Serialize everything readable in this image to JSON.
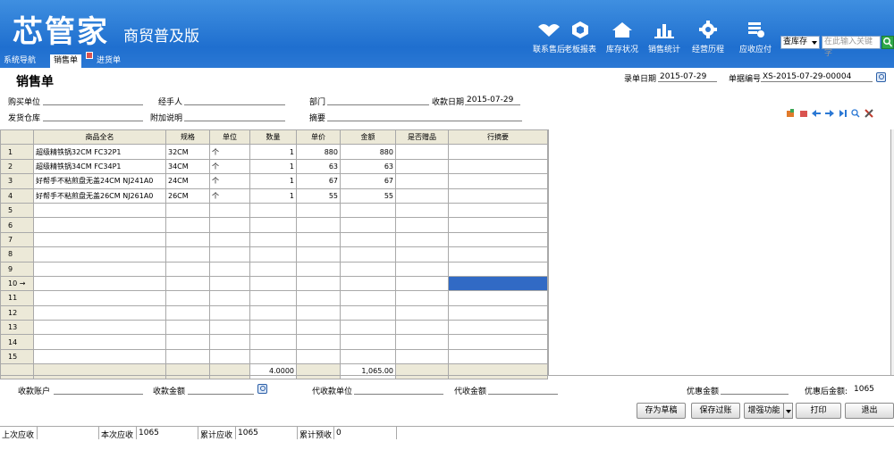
{
  "app": {
    "logo": "芯管家",
    "edition": "商贸普及版"
  },
  "nav": [
    {
      "label": "联系售后",
      "icon": "handshake-icon"
    },
    {
      "label": "老板报表",
      "icon": "report-icon"
    },
    {
      "label": "库存状况",
      "icon": "home-icon"
    },
    {
      "label": "销售统计",
      "icon": "bar-chart-icon"
    },
    {
      "label": "经营历程",
      "icon": "gear-icon"
    },
    {
      "label": "应收应付",
      "icon": "ledger-icon"
    }
  ],
  "search": {
    "scope": "查库存",
    "placeholder": "在此输入关键字"
  },
  "tabs": [
    "系统导航",
    "销售单",
    "进货单"
  ],
  "form": {
    "title": "销售单",
    "entry_date_label": "录单日期",
    "entry_date": "2015-07-29",
    "doc_no_label": "单据编号",
    "doc_no": "XS-2015-07-29-00004",
    "buyer_label": "购买单位",
    "handler_label": "经手人",
    "dept_label": "部门",
    "pay_date_label": "收款日期",
    "pay_date": "2015-07-29",
    "warehouse_label": "发货仓库",
    "note_label": "附加说明",
    "summary_label": "摘要"
  },
  "grid": {
    "headers": [
      "商品全名",
      "规格",
      "单位",
      "数量",
      "单价",
      "金额",
      "是否赠品",
      "行摘要"
    ],
    "rows": [
      {
        "n": "1",
        "name": "超级精铁锅32CM FC32P1",
        "spec": "32CM",
        "unit": "个",
        "qty": "1",
        "price": "880",
        "amount": "880"
      },
      {
        "n": "2",
        "name": "超级精铁锅34CM FC34P1",
        "spec": "34CM",
        "unit": "个",
        "qty": "1",
        "price": "63",
        "amount": "63"
      },
      {
        "n": "3",
        "name": "好帮手不粘煎盘无盖24CM NJ241A0",
        "spec": "24CM",
        "unit": "个",
        "qty": "1",
        "price": "67",
        "amount": "67"
      },
      {
        "n": "4",
        "name": "好帮手不粘煎盘无盖26CM NJ261A0",
        "spec": "26CM",
        "unit": "个",
        "qty": "1",
        "price": "55",
        "amount": "55"
      },
      {
        "n": "5"
      },
      {
        "n": "6"
      },
      {
        "n": "7"
      },
      {
        "n": "8"
      },
      {
        "n": "9"
      },
      {
        "n": "10 →"
      },
      {
        "n": "11"
      },
      {
        "n": "12"
      },
      {
        "n": "13"
      },
      {
        "n": "14"
      },
      {
        "n": "15"
      }
    ],
    "total_qty": "4.0000",
    "total_amount": "1,065.00"
  },
  "footer": {
    "account_label": "收款账户",
    "received_label": "收款金额",
    "agent_unit_label": "代收款单位",
    "agent_amount_label": "代收金额",
    "discount_label": "优惠金额",
    "after_discount_label": "优惠后金额:",
    "after_discount": "1065"
  },
  "buttons": {
    "draft": "存为草稿",
    "post": "保存过账",
    "enhance": "增强功能",
    "print": "打印",
    "exit": "退出"
  },
  "status": {
    "last_receivable_label": "上次应收",
    "last_receivable": "",
    "this_receivable_label": "本次应收",
    "this_receivable": "1065",
    "total_receivable_label": "累计应收",
    "total_receivable": "1065",
    "total_prepaid_label": "累计预收",
    "total_prepaid": "0"
  },
  "colors": {
    "header_blue": "#2b78d4",
    "selected_cell": "#316ac5",
    "grid_header": "#ece9d8"
  }
}
